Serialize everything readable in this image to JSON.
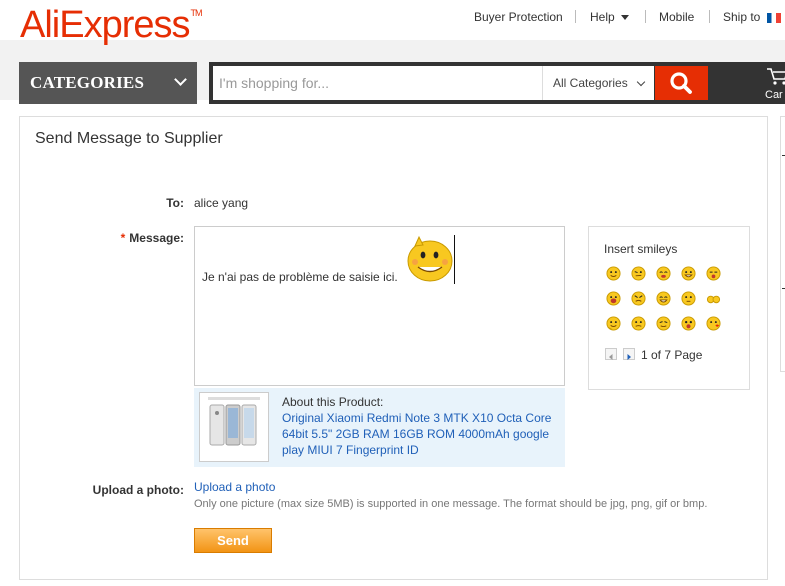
{
  "header": {
    "logo": "AliExpress",
    "logo_tm": "TM",
    "links": {
      "buyer_protection": "Buyer Protection",
      "help": "Help",
      "mobile": "Mobile",
      "ship_to": "Ship to"
    },
    "categories_label": "CATEGORIES",
    "search": {
      "placeholder": "I'm shopping for...",
      "category": "All Categories"
    },
    "cart_label": "Car"
  },
  "form": {
    "title": "Send Message to Supplier",
    "to_label": "To:",
    "to_value": "alice yang",
    "required_mark": "*",
    "message_label": "Message:",
    "message_text": "Je n'ai pas de problème de saisie ici.",
    "smileys": {
      "title": "Insert smileys",
      "page_text": "1 of 7 Page"
    },
    "product": {
      "about_label": "About this Product:",
      "link_text": "Original Xiaomi Redmi Note 3 MTK X10 Octa Core 64bit 5.5\" 2GB RAM 16GB ROM 4000mAh google play MIUI 7 Fingerprint ID"
    },
    "upload_label": "Upload a photo:",
    "upload_link": "Upload a photo",
    "upload_note": "Only one picture (max size 5MB) is supported in one message. The format should be jpg, png, gif or bmp.",
    "send_label": "Send"
  },
  "colors": {
    "brand": "#e62e04",
    "link": "#2060b8",
    "button": "#f29415"
  }
}
